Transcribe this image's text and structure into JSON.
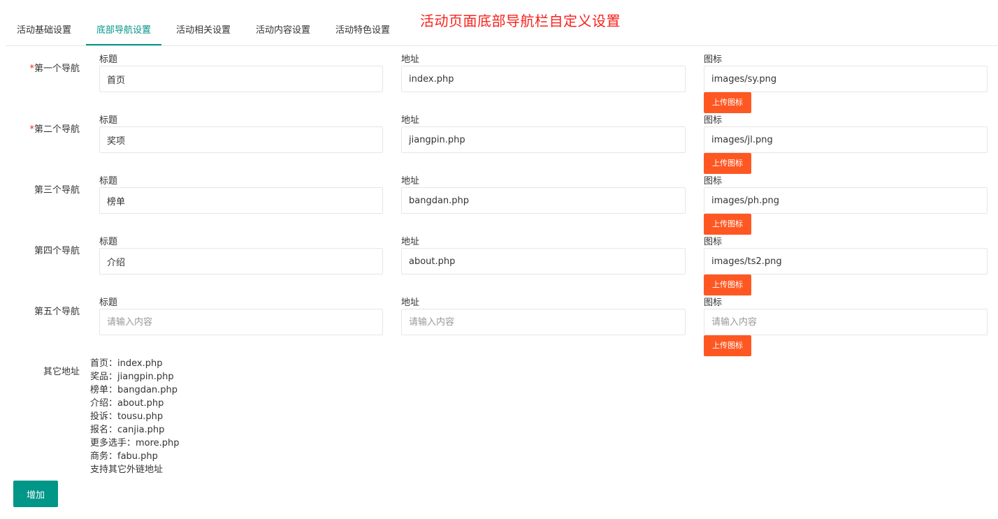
{
  "banner_title": "活动页面底部导航栏自定义设置",
  "tabs": [
    {
      "label": "活动基础设置"
    },
    {
      "label": "底部导航设置"
    },
    {
      "label": "活动相关设置"
    },
    {
      "label": "活动内容设置"
    },
    {
      "label": "活动特色设置"
    }
  ],
  "field_labels": {
    "title": "标题",
    "url": "地址",
    "icon": "图标"
  },
  "upload_label": "上传图标",
  "placeholder": "请输入内容",
  "nav_rows": [
    {
      "label": "第一个导航",
      "required": "*",
      "title": "首页",
      "url": "index.php",
      "icon": "images/sy.png"
    },
    {
      "label": "第二个导航",
      "required": "*",
      "title": "奖项",
      "url": "jiangpin.php",
      "icon": "images/jl.png"
    },
    {
      "label": "第三个导航",
      "required": "",
      "title": "榜单",
      "url": "bangdan.php",
      "icon": "images/ph.png"
    },
    {
      "label": "第四个导航",
      "required": "",
      "title": "介绍",
      "url": "about.php",
      "icon": "images/ts2.png"
    },
    {
      "label": "第五个导航",
      "required": "",
      "title": "",
      "url": "",
      "icon": ""
    }
  ],
  "other_addresses": {
    "label": "其它地址",
    "items": [
      "首页：index.php",
      "奖品：jiangpin.php",
      "榜单：bangdan.php",
      "介绍：about.php",
      "投诉：tousu.php",
      "报名：canjia.php",
      "更多选手：more.php",
      "商务：fabu.php",
      "支持其它外链地址"
    ]
  },
  "add_button": "增加",
  "colors": {
    "accent": "#009688",
    "upload": "#ff5722",
    "banner": "#f5221b"
  }
}
